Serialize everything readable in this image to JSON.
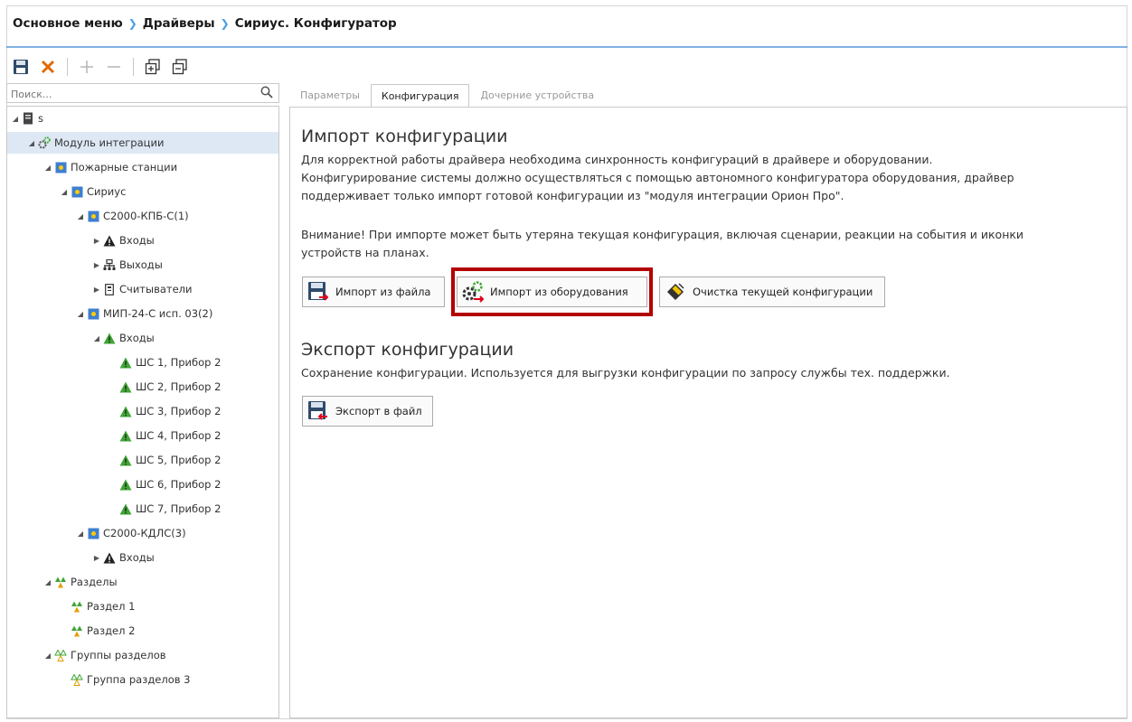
{
  "breadcrumb": {
    "items": [
      "Основное меню",
      "Драйверы",
      "Сириус. Конфигуратор"
    ],
    "separator": "❯"
  },
  "toolbar": {
    "icons": [
      "save-icon",
      "cancel-icon",
      "add-icon",
      "remove-icon",
      "expand-all-icon",
      "collapse-all-icon"
    ]
  },
  "search": {
    "placeholder": "Поиск..."
  },
  "tree": {
    "root": "s",
    "module": "Модуль интеграции",
    "fire_stations": "Пожарные станции",
    "sirius": "Сириус",
    "kpb": "С2000-КПБ-С(1)",
    "kpb_inputs": "Входы",
    "kpb_outputs": "Выходы",
    "kpb_readers": "Считыватели",
    "mip": "МИП-24-С исп. 03(2)",
    "mip_inputs": "Входы",
    "mip_items": [
      "ШС 1, Прибор 2",
      "ШС 2, Прибор 2",
      "ШС 3, Прибор 2",
      "ШС 4, Прибор 2",
      "ШС 5, Прибор 2",
      "ШС 6, Прибор 2",
      "ШС 7, Прибор 2"
    ],
    "kdls": "С2000-КДЛС(3)",
    "kdls_inputs": "Входы",
    "sections": "Разделы",
    "section_items": [
      "Раздел 1",
      "Раздел 2"
    ],
    "groups": "Группы разделов",
    "group_items": [
      "Группа разделов 3"
    ]
  },
  "tabs": {
    "params": "Параметры",
    "config": "Конфигурация",
    "children": "Дочерние устройства",
    "active": "Конфигурация"
  },
  "import": {
    "title": "Импорт конфигурации",
    "line1": "Для корректной работы драйвера необходима синхронность конфигураций в драйвере и оборудовании.",
    "line2": "Конфигурирование системы должно осуществляться с помощью автономного конфигуратора оборудования, драйвер",
    "line3": "поддерживает только импорт готовой конфигурации из \"модуля интеграции Орион Про\".",
    "warn1": "Внимание! При импорте может быть утеряна текущая конфигурация, включая сценарии, реакции на события и иконки",
    "warn2": "устройств на планах.",
    "btn_file": "Импорт из файла",
    "btn_equipment": "Импорт из оборудования",
    "btn_clear": "Очистка текущей конфигурации"
  },
  "export": {
    "title": "Экспорт конфигурации",
    "desc": "Сохранение конфигурации. Используется для выгрузки конфигурации по запросу службы тех. поддержки.",
    "btn_file": "Экспорт в файл"
  },
  "colors": {
    "accent": "#4a90d9",
    "highlight": "#b30000",
    "selected_row": "#dde8f4",
    "warning_green": "#3fa535"
  }
}
